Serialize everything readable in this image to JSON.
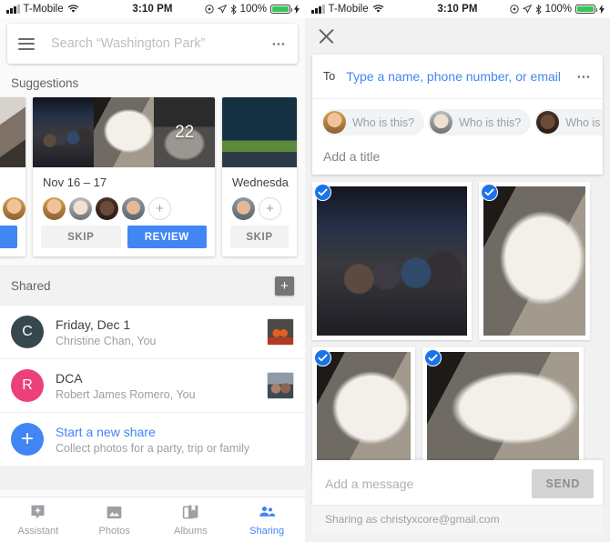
{
  "status_bar": {
    "carrier": "T-Mobile",
    "time": "3:10 PM",
    "battery_percent": "100%",
    "icons": [
      "signal-bars-icon",
      "wifi-icon",
      "location-arrow-icon",
      "bluetooth-icon",
      "battery-icon",
      "charging-bolt-icon"
    ]
  },
  "left_pane": {
    "search": {
      "placeholder": "Search “Washington Park”",
      "menu_icon": "hamburger-menu-icon",
      "overflow_icon": "overflow-dots-icon"
    },
    "suggestions": {
      "title": "Suggestions",
      "cards": [
        {
          "date": "Nov 16 – 17",
          "photo_overlay_count": "22",
          "skip_label": "SKIP",
          "review_label": "REVIEW",
          "faces": [
            "face-blonde-woman",
            "face-older-man-sunglasses",
            "face-bearded-man",
            "face-young-man"
          ],
          "add_face_label": "+"
        },
        {
          "date": "Wednesda",
          "skip_label": "SKIP",
          "faces": [
            "face-young-man"
          ],
          "add_face_label": "+"
        }
      ]
    },
    "shared": {
      "header": "Shared",
      "add_label": "+",
      "rows": [
        {
          "initial": "C",
          "initial_color": "#37474f",
          "title": "Friday, Dec 1",
          "subtitle": "Christine Chan, You",
          "thumb": "photo-figurines"
        },
        {
          "initial": "R",
          "initial_color": "#ec407a",
          "title": "DCA",
          "subtitle": "Robert James Romero, You",
          "thumb": "photo-selfie-couple"
        }
      ],
      "new_share": {
        "icon": "plus-circle-icon",
        "title": "Start a new share",
        "subtitle": "Collect photos for a party, trip or family"
      }
    },
    "tab_bar": {
      "active": "Sharing",
      "tabs": [
        {
          "label": "Assistant",
          "icon": "assistant-sparkle-icon"
        },
        {
          "label": "Photos",
          "icon": "photo-mountain-icon"
        },
        {
          "label": "Albums",
          "icon": "albums-stack-icon"
        },
        {
          "label": "Sharing",
          "icon": "people-sharing-icon"
        }
      ]
    }
  },
  "right_pane": {
    "close_icon": "close-x-icon",
    "to_label": "To",
    "to_placeholder": "Type a name, phone number, or email",
    "overflow_icon": "overflow-dots-icon",
    "suggestion_chips": [
      {
        "label": "Who is this?",
        "face": "face-blonde-woman"
      },
      {
        "label": "Who is this?",
        "face": "face-older-man-sunglasses"
      },
      {
        "label": "Who is this?",
        "face": "face-bearded-man"
      }
    ],
    "title_placeholder": "Add a title",
    "photos": [
      {
        "name": "photo-family-group-christmas",
        "selected": true,
        "art": "a-group"
      },
      {
        "name": "photo-white-dog-floor",
        "selected": true,
        "art": "a-dog"
      },
      {
        "name": "photo-white-dog-carpet",
        "selected": true,
        "art": "a-dog"
      },
      {
        "name": "photo-white-dog-closeup",
        "selected": true,
        "art": "a-dog"
      }
    ],
    "message_placeholder": "Add a message",
    "send_label": "SEND",
    "sharing_as": "Sharing as christyxcore@gmail.com"
  },
  "colors": {
    "accent_blue": "#4285f4",
    "check_blue": "#1a73e8",
    "battery_green": "#35c759",
    "pink": "#ec407a",
    "slate": "#37474f"
  }
}
